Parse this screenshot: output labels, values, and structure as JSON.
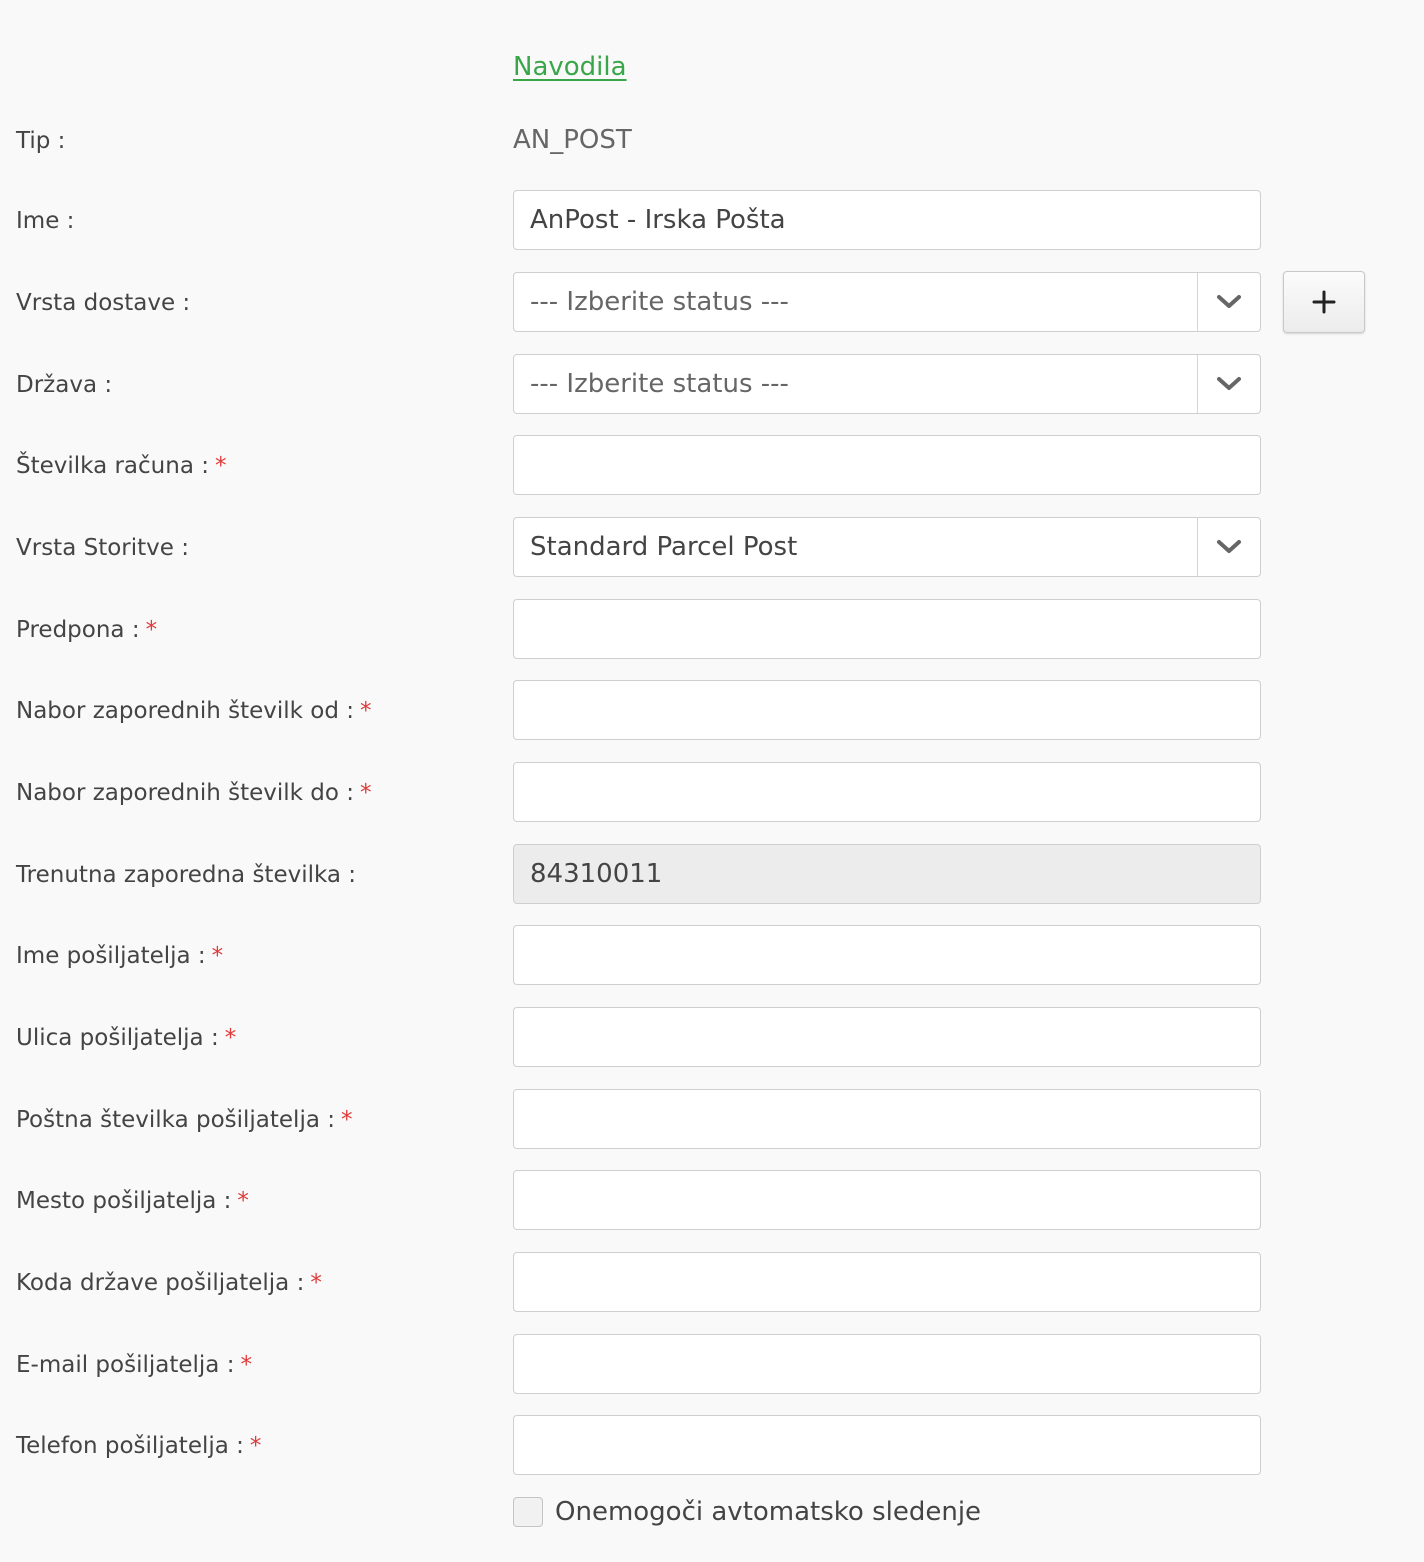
{
  "instructions_link": "Navodila",
  "type_row": {
    "label": "Tip :",
    "value": "AN_POST"
  },
  "name_row": {
    "label": "Ime :",
    "value": "AnPost - Irska Pošta"
  },
  "delivery_type_row": {
    "label": "Vrsta dostave :",
    "selected": "--- Izberite status ---",
    "add_label": "+"
  },
  "country_row": {
    "label": "Država :",
    "selected": "--- Izberite status ---"
  },
  "account_number_row": {
    "label": "Številka računa :",
    "required": "*",
    "value": ""
  },
  "service_type_row": {
    "label": "Vrsta Storitve :",
    "selected": "Standard Parcel Post"
  },
  "prefix_row": {
    "label": "Predpona :",
    "required": "*",
    "value": ""
  },
  "sequence_from_row": {
    "label": "Nabor zaporednih številk od :",
    "required": "*",
    "value": ""
  },
  "sequence_to_row": {
    "label": "Nabor zaporednih številk do :",
    "required": "*",
    "value": ""
  },
  "current_sequence_row": {
    "label": "Trenutna zaporedna številka :",
    "value": "84310011"
  },
  "sender_name_row": {
    "label": "Ime pošiljatelja :",
    "required": "*",
    "value": ""
  },
  "sender_street_row": {
    "label": "Ulica pošiljatelja :",
    "required": "*",
    "value": ""
  },
  "sender_postcode_row": {
    "label": "Poštna številka pošiljatelja :",
    "required": "*",
    "value": ""
  },
  "sender_city_row": {
    "label": "Mesto pošiljatelja :",
    "required": "*",
    "value": ""
  },
  "sender_country_code_row": {
    "label": "Koda države pošiljatelja :",
    "required": "*",
    "value": ""
  },
  "sender_email_row": {
    "label": "E-mail pošiljatelja :",
    "required": "*",
    "value": ""
  },
  "sender_phone_row": {
    "label": "Telefon pošiljatelja :",
    "required": "*",
    "value": ""
  },
  "disable_tracking": {
    "label": "Onemogoči avtomatsko sledenje",
    "checked": false
  },
  "colors": {
    "link": "#3aa64a",
    "required": "#e03a3a",
    "background": "#f9f9f9",
    "readonly_field": "#ececec"
  },
  "icons": {
    "select_arrow": "chevron-down-icon",
    "add": "plus-icon"
  }
}
